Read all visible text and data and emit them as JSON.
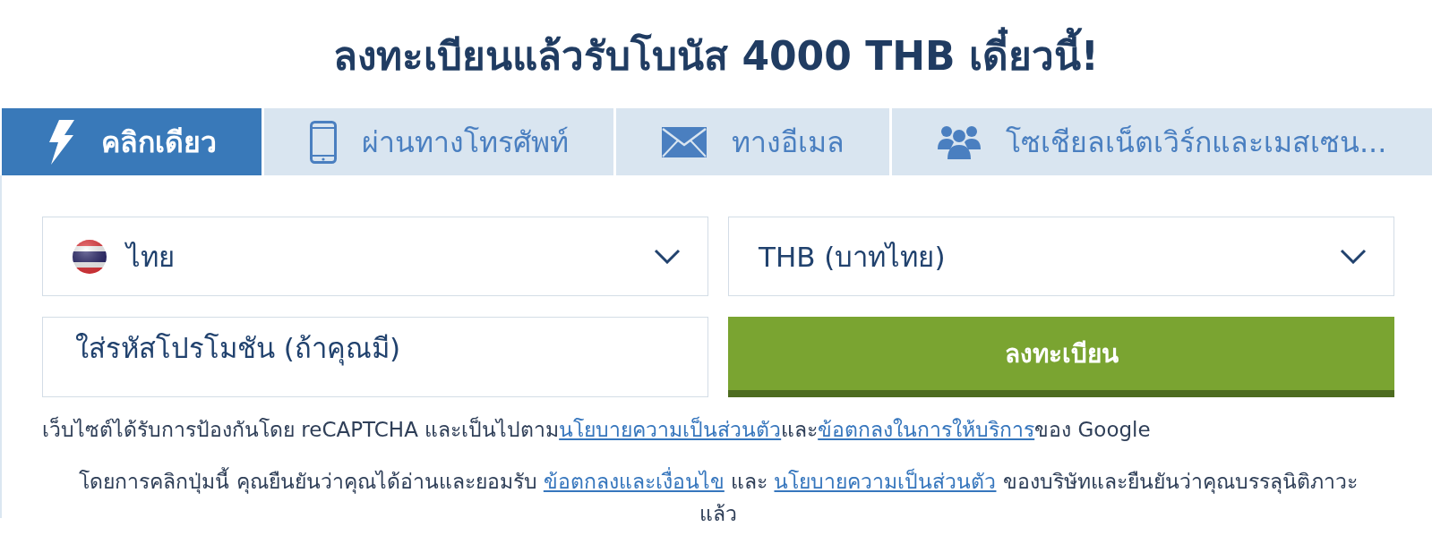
{
  "heading": {
    "text": "ลงทะเบียนแล้วรับโบนัส 4000 THB เดี๋ยวนี้!"
  },
  "tabs": [
    {
      "kind": "bolt",
      "label": "คลิกเดียว",
      "selected": true
    },
    {
      "kind": "phone",
      "label": "ผ่านทางโทรศัพท์",
      "selected": false
    },
    {
      "kind": "email",
      "label": "ทางอีเมล",
      "selected": false
    },
    {
      "kind": "social",
      "label": "โซเชียลเน็ตเวิร์กและเมสเซน...",
      "selected": false
    }
  ],
  "form": {
    "country_select": {
      "value": "ไทย"
    },
    "currency_select": {
      "value": "THB (บาทไทย)"
    },
    "promo_code": {
      "placeholder": "ใส่รหัสโปรโมชัน (ถ้าคุณมี)"
    },
    "register_button": {
      "label": "ลงทะเบียน"
    }
  },
  "recaptcha_notice": [
    {
      "kind": "text",
      "text": "เว็บไซต์ได้รับการป้องกันโดย reCAPTCHA และเป็นไปตาม"
    },
    {
      "kind": "link",
      "text": "นโยบายความเป็นส่วนตัว"
    },
    {
      "kind": "text",
      "text": "และ"
    },
    {
      "kind": "link",
      "text": "ข้อตกลงในการให้บริการ"
    },
    {
      "kind": "text",
      "text": "ของ Google"
    }
  ],
  "consent_notice": [
    {
      "kind": "text",
      "text": "โดยการคลิกปุ่มนี้ คุณยืนยันว่าคุณได้อ่านและยอมรับ "
    },
    {
      "kind": "link",
      "text": "ข้อตกลงและเงื่อนไข"
    },
    {
      "kind": "text",
      "text": " และ "
    },
    {
      "kind": "link",
      "text": "นโยบายความเป็นส่วนตัว"
    },
    {
      "kind": "text",
      "text": " ของบริษัทและยืนยันว่าคุณบรรลุนิติภาวะแล้ว"
    }
  ]
}
